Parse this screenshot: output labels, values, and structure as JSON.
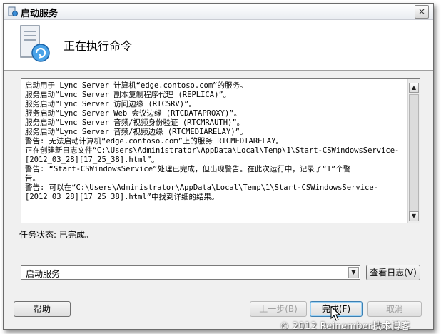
{
  "window": {
    "title": "启动服务",
    "close_label": "×"
  },
  "header": {
    "title": "正在执行命令"
  },
  "log": {
    "lines": [
      "启动用于 Lync Server 计算机“edge.contoso.com”的服务。",
      "服务启动“Lync Server 副本复制程序代理 (REPLICA)”。",
      "服务启动“Lync Server 访问边缘 (RTCSRV)”。",
      "服务启动“Lync Server Web 会议边缘 (RTCDATAPROXY)”。",
      "服务启动“Lync Server 音频/视频身份验证 (RTCMRAUTH)”。",
      "服务启动“Lync Server 音频/视频边缘 (RTCMEDIARELAY)”。",
      "警告: 无法启动计算机“edge.contoso.com”上的服务 RTCMEDIARELAY。",
      "正在创建新日志文件“C:\\Users\\Administrator\\AppData\\Local\\Temp\\1\\Start-CSWindowsService-",
      "[2012_03_28][17_25_38].html”。",
      "警告: “Start-CSWindowsService”处理已完成，但出现警告。在此次运行中，记录了“1”个警",
      "告。",
      "警告: 可以在“C:\\Users\\Administrator\\AppData\\Local\\Temp\\1\\Start-CSWindowsService-",
      "[2012_03_28][17_25_38].html”中找到详细的结果。"
    ]
  },
  "status": {
    "text": "任务状态: 已完成。"
  },
  "combo": {
    "value": "启动服务"
  },
  "buttons": {
    "view_log": "查看日志(V)",
    "help": "帮助",
    "back": "上一步(B)",
    "finish": "完成(F)",
    "cancel": "取消"
  },
  "watermark": "© 2012 Reinember技术博客",
  "colors": {
    "accent_border": "#3c7fb1",
    "disabled_text": "#a0a0a0"
  }
}
